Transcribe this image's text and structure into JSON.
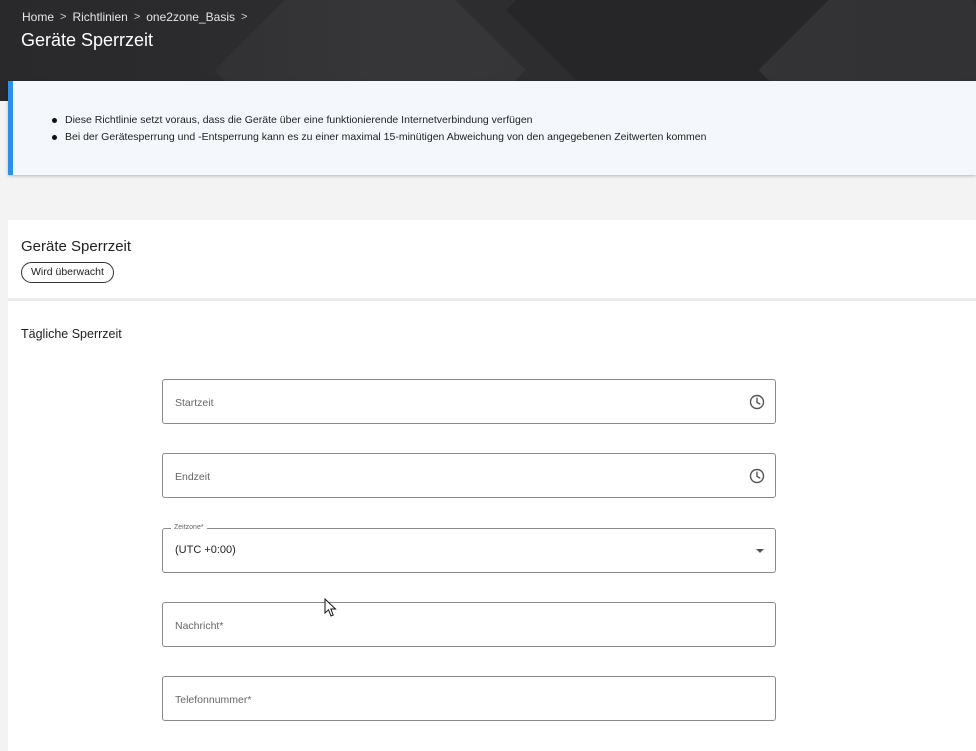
{
  "breadcrumb": {
    "items": [
      "Home",
      "Richtlinien",
      "one2zone_Basis"
    ],
    "separator": ">"
  },
  "page": {
    "title": "Geräte Sperrzeit"
  },
  "info": {
    "items": [
      "Diese Richtlinie setzt voraus, dass die Geräte über eine funktionierende Internetverbindung verfügen",
      "Bei der Gerätesperrung und -Entsperrung kann es zu einer maximal 15-minütigen Abweichung von den angegebenen Zeitwerten kommen"
    ],
    "accent_color": "#2f8fe6"
  },
  "card": {
    "title": "Geräte Sperrzeit",
    "badge": "Wird überwacht",
    "section_label": "Tägliche Sperrzeit"
  },
  "form": {
    "start_placeholder": "Startzeit",
    "end_placeholder": "Endzeit",
    "timezone_label": "Zeitzone*",
    "timezone_value": "(UTC +0:00)",
    "message_placeholder": "Nachricht*",
    "phone_placeholder": "Telefonnummer*",
    "icons": {
      "time": "clock-icon",
      "select": "chevron-down-icon"
    }
  }
}
